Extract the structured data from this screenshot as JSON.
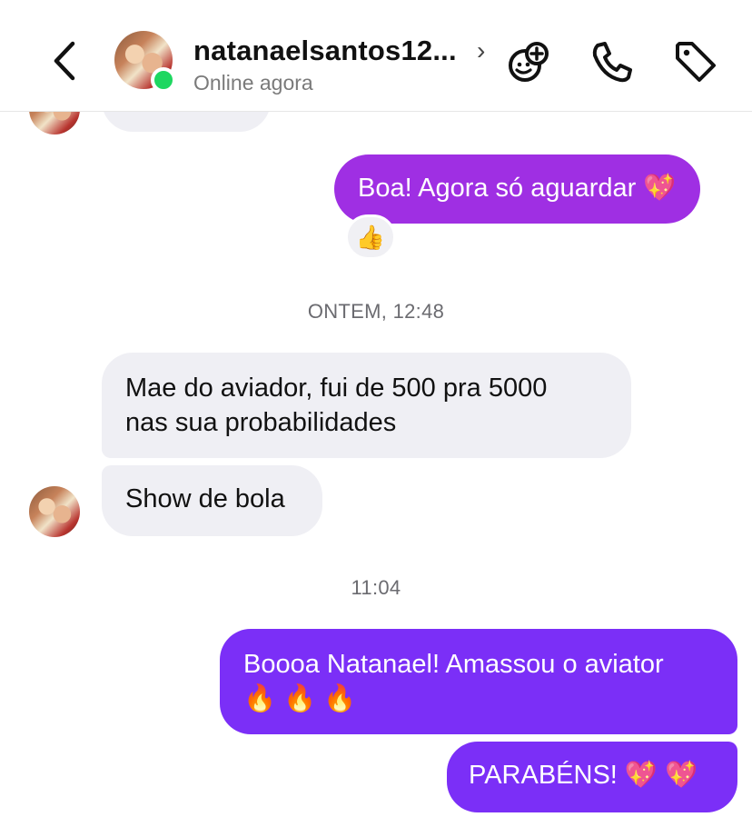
{
  "header": {
    "username": "natanaelsantos12...",
    "chevron": "›",
    "status": "Online agora",
    "icons": [
      "back-arrow-icon",
      "add-effect-icon",
      "phone-icon",
      "tag-icon"
    ]
  },
  "messages": {
    "prev_partial": "",
    "sent_1": "Boa! Agora só aguardar 💖",
    "reaction_1": "👍",
    "timestamp_1": "ONTEM, 12:48",
    "recv_1_line1": "Mae do aviador, fui de 500 pra 5000",
    "recv_1_line2": "nas sua probabilidades",
    "recv_2": "Show de bola",
    "timestamp_2": "11:04",
    "sent_2_line1": "Boooa Natanael! Amassou o aviator",
    "sent_2_line2": "🔥 🔥 🔥",
    "sent_3": "PARABÉNS! 💖 💖"
  },
  "colors": {
    "accent_purple": "#7b2ff7",
    "accent_magenta": "#9f2fe3",
    "incoming_bubble": "#efeff4",
    "online_green": "#1ed760"
  }
}
